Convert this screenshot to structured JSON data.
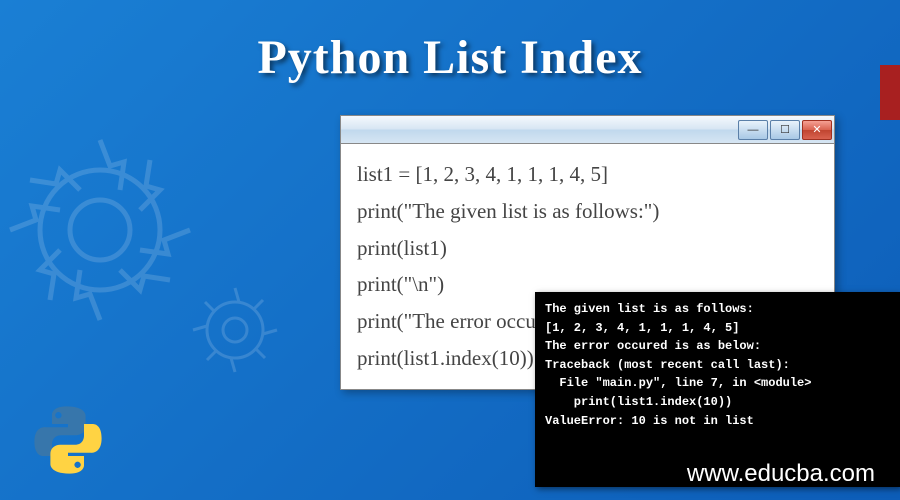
{
  "title": "Python List Index",
  "code_window": {
    "lines": [
      "list1 = [1, 2, 3, 4, 1, 1, 1, 4, 5]",
      "print(\"The given list is as follows:\")",
      "print(list1)",
      "print(\"\\n\")",
      "print(\"The error occured is as below:\")",
      "print(list1.index(10))"
    ]
  },
  "terminal": {
    "lines": [
      "The given list is as follows:",
      "[1, 2, 3, 4, 1, 1, 1, 4, 5]",
      "",
      "",
      "The error occured is as below:",
      "Traceback (most recent call last):",
      "  File \"main.py\", line 7, in <module>",
      "    print(list1.index(10))",
      "ValueError: 10 is not in list"
    ]
  },
  "footer": "www.educba.com",
  "window_controls": {
    "min": "—",
    "max": "☐",
    "close": "✕"
  }
}
